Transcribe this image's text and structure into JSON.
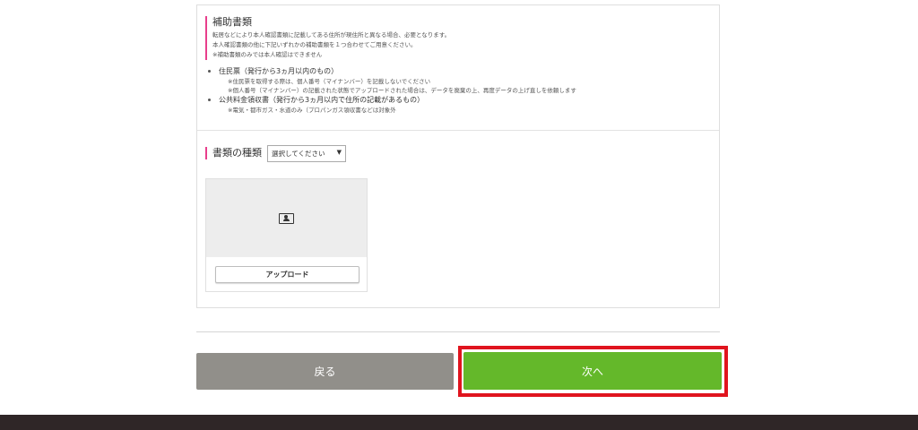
{
  "aux_docs": {
    "title": "補助書類",
    "lines": [
      "転居などにより本人確認書類に記載してある住所が現住所と異なる場合、必要となります。",
      "本人確認書類の他に下記いずれかの補助書類を１つ合わせてご用意ください。",
      "※補助書類のみでは本人確認はできません"
    ],
    "items": [
      {
        "label": "住民票（発行から3ヵ月以内のもの）",
        "notes": [
          "※住民票を取得する際は、個人番号（マイナンバー）を記載しないでください",
          "※個人番号（マイナンバー）の記載された状態でアップロードされた場合は、データを廃棄の上、再度データの上げ直しを依頼します"
        ]
      },
      {
        "label": "公共料金領収書（発行から3ヵ月以内で住所の記載があるもの）",
        "notes": [
          "※電気・都市ガス・水道のみ（プロパンガス領収書などは対象外"
        ]
      }
    ]
  },
  "doc_type": {
    "label": "書類の種類",
    "select_value": "選択してください",
    "select_arrow": "▼"
  },
  "upload": {
    "icon": "id-card-icon",
    "button_label": "アップロード"
  },
  "nav": {
    "back_label": "戻る",
    "next_label": "次へ"
  },
  "colors": {
    "accent_pink": "#e83e8c",
    "back_gray": "#918f8a",
    "next_green": "#64b82a",
    "highlight_red": "#e0141e",
    "footer_dark": "#2f2627"
  }
}
